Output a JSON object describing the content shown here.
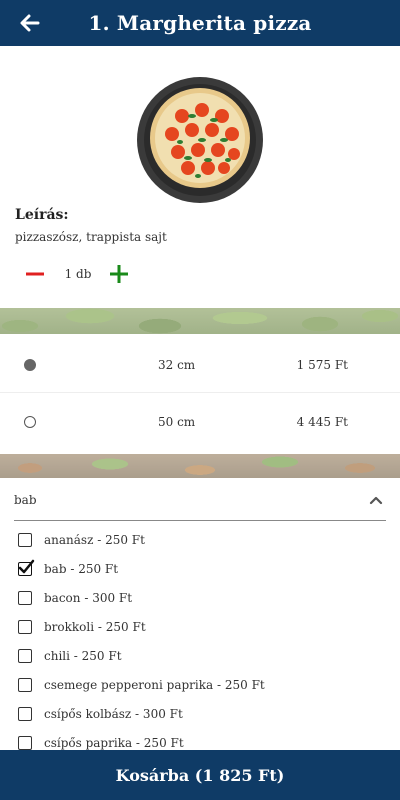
{
  "header": {
    "title": "1. Margherita pizza",
    "back_icon": "arrow-left-icon"
  },
  "product": {
    "image_alt": "Margherita pizza",
    "description_title": "Leírás:",
    "description": "pizzaszósz, trappista sajt"
  },
  "quantity": {
    "value": "1 db",
    "minus_icon": "minus-icon",
    "plus_icon": "plus-icon"
  },
  "sizes": [
    {
      "label": "32 cm",
      "price": "1 575 Ft",
      "selected": true
    },
    {
      "label": "50 cm",
      "price": "4 445 Ft",
      "selected": false
    }
  ],
  "toppings_dropdown": {
    "selected": "bab",
    "chevron_icon": "chevron-up-icon"
  },
  "toppings": [
    {
      "label": "ananász - 250 Ft",
      "checked": false
    },
    {
      "label": "bab - 250 Ft",
      "checked": true
    },
    {
      "label": "bacon - 300 Ft",
      "checked": false
    },
    {
      "label": "brokkoli - 250 Ft",
      "checked": false
    },
    {
      "label": "chili - 250 Ft",
      "checked": false
    },
    {
      "label": "csemege pepperoni paprika - 250 Ft",
      "checked": false
    },
    {
      "label": "csípős kolbász - 300 Ft",
      "checked": false
    },
    {
      "label": "csípős paprika - 250 Ft",
      "checked": false
    }
  ],
  "cart_button": {
    "label": "Kosárba (1 825 Ft)"
  },
  "colors": {
    "primary": "#0f3b66",
    "minus": "#e02020",
    "plus": "#1a8a1a"
  }
}
